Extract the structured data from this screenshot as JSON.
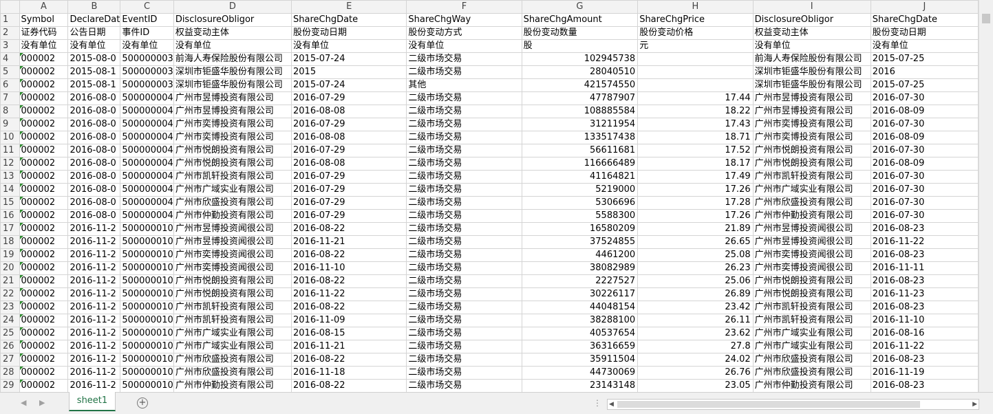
{
  "columns": [
    {
      "letter": "A",
      "w": 72
    },
    {
      "letter": "B",
      "w": 72
    },
    {
      "letter": "C",
      "w": 72
    },
    {
      "letter": "D",
      "w": 172
    },
    {
      "letter": "E",
      "w": 172
    },
    {
      "letter": "F",
      "w": 172
    },
    {
      "letter": "G",
      "w": 172
    },
    {
      "letter": "H",
      "w": 172
    },
    {
      "letter": "I",
      "w": 172
    },
    {
      "letter": "J",
      "w": 160
    }
  ],
  "rows": [
    [
      "Symbol",
      "DeclareDat",
      "EventID",
      "DisclosureObligor",
      "ShareChgDate",
      "ShareChgWay",
      "ShareChgAmount",
      "ShareChgPrice",
      "DisclosureObligor",
      "ShareChgDate"
    ],
    [
      "证券代码",
      "公告日期",
      "事件ID",
      "权益变动主体",
      "股份变动日期",
      "股份变动方式",
      "股份变动数量",
      "股份变动价格",
      "权益变动主体",
      "股份变动日期"
    ],
    [
      "没有单位",
      "没有单位",
      "没有单位",
      "没有单位",
      "没有单位",
      "没有单位",
      "股",
      "元",
      "没有单位",
      "没有单位"
    ],
    [
      "000002",
      "2015-08-0",
      "500000003",
      "前海人寿保险股份有限公司",
      "2015-07-24",
      "二级市场交易",
      "102945738",
      "",
      "前海人寿保险股份有限公司",
      "2015-07-25"
    ],
    [
      "000002",
      "2015-08-1",
      "500000003",
      "深圳市钜盛华股份有限公司",
      "2015",
      "二级市场交易",
      "28040510",
      "",
      "深圳市钜盛华股份有限公司",
      "2016"
    ],
    [
      "000002",
      "2015-08-1",
      "500000003",
      "深圳市钜盛华股份有限公司",
      "2015-07-24",
      "其他",
      "421574550",
      "",
      "深圳市钜盛华股份有限公司",
      "2015-07-25"
    ],
    [
      "000002",
      "2016-08-0",
      "500000004",
      "广州市昱博投资有限公司",
      "2016-07-29",
      "二级市场交易",
      "47787907",
      "17.44",
      "广州市昱博投资有限公司",
      "2016-07-30"
    ],
    [
      "000002",
      "2016-08-0",
      "500000004",
      "广州市昱博投资有限公司",
      "2016-08-08",
      "二级市场交易",
      "108885584",
      "18.22",
      "广州市昱博投资有限公司",
      "2016-08-09"
    ],
    [
      "000002",
      "2016-08-0",
      "500000004",
      "广州市奕博投资有限公司",
      "2016-07-29",
      "二级市场交易",
      "31211954",
      "17.43",
      "广州市奕博投资有限公司",
      "2016-07-30"
    ],
    [
      "000002",
      "2016-08-0",
      "500000004",
      "广州市奕博投资有限公司",
      "2016-08-08",
      "二级市场交易",
      "133517438",
      "18.71",
      "广州市奕博投资有限公司",
      "2016-08-09"
    ],
    [
      "000002",
      "2016-08-0",
      "500000004",
      "广州市悦朗投资有限公司",
      "2016-07-29",
      "二级市场交易",
      "56611681",
      "17.52",
      "广州市悦朗投资有限公司",
      "2016-07-30"
    ],
    [
      "000002",
      "2016-08-0",
      "500000004",
      "广州市悦朗投资有限公司",
      "2016-08-08",
      "二级市场交易",
      "116666489",
      "18.17",
      "广州市悦朗投资有限公司",
      "2016-08-09"
    ],
    [
      "000002",
      "2016-08-0",
      "500000004",
      "广州市凯轩投资有限公司",
      "2016-07-29",
      "二级市场交易",
      "41164821",
      "17.49",
      "广州市凯轩投资有限公司",
      "2016-07-30"
    ],
    [
      "000002",
      "2016-08-0",
      "500000004",
      "广州市广域实业有限公司",
      "2016-07-29",
      "二级市场交易",
      "5219000",
      "17.26",
      "广州市广域实业有限公司",
      "2016-07-30"
    ],
    [
      "000002",
      "2016-08-0",
      "500000004",
      "广州市欣盛投资有限公司",
      "2016-07-29",
      "二级市场交易",
      "5306696",
      "17.28",
      "广州市欣盛投资有限公司",
      "2016-07-30"
    ],
    [
      "000002",
      "2016-08-0",
      "500000004",
      "广州市仲勤投资有限公司",
      "2016-07-29",
      "二级市场交易",
      "5588300",
      "17.26",
      "广州市仲勤投资有限公司",
      "2016-07-30"
    ],
    [
      "000002",
      "2016-11-2",
      "500000010",
      "广州市昱博投资闻很公司",
      "2016-08-22",
      "二级市场交易",
      "16580209",
      "21.89",
      "广州市昱博投资闻很公司",
      "2016-08-23"
    ],
    [
      "000002",
      "2016-11-2",
      "500000010",
      "广州市昱博投资闻很公司",
      "2016-11-21",
      "二级市场交易",
      "37524855",
      "26.65",
      "广州市昱博投资闻很公司",
      "2016-11-22"
    ],
    [
      "000002",
      "2016-11-2",
      "500000010",
      "广州市奕博投资闻很公司",
      "2016-08-22",
      "二级市场交易",
      "4461200",
      "25.08",
      "广州市奕博投资闻很公司",
      "2016-08-23"
    ],
    [
      "000002",
      "2016-11-2",
      "500000010",
      "广州市奕博投资闻很公司",
      "2016-11-10",
      "二级市场交易",
      "38082989",
      "26.23",
      "广州市奕博投资闻很公司",
      "2016-11-11"
    ],
    [
      "000002",
      "2016-11-2",
      "500000010",
      "广州市悦朗投资有限公司",
      "2016-08-22",
      "二级市场交易",
      "2227527",
      "25.06",
      "广州市悦朗投资有限公司",
      "2016-08-23"
    ],
    [
      "000002",
      "2016-11-2",
      "500000010",
      "广州市悦朗投资有限公司",
      "2016-11-22",
      "二级市场交易",
      "30226117",
      "26.89",
      "广州市悦朗投资有限公司",
      "2016-11-23"
    ],
    [
      "000002",
      "2016-11-2",
      "500000010",
      "广州市凯轩投资有限公司",
      "2016-08-22",
      "二级市场交易",
      "44048154",
      "23.42",
      "广州市凯轩投资有限公司",
      "2016-08-23"
    ],
    [
      "000002",
      "2016-11-2",
      "500000010",
      "广州市凯轩投资有限公司",
      "2016-11-09",
      "二级市场交易",
      "38288100",
      "26.11",
      "广州市凯轩投资有限公司",
      "2016-11-10"
    ],
    [
      "000002",
      "2016-11-2",
      "500000010",
      "广州市广域实业有限公司",
      "2016-08-15",
      "二级市场交易",
      "40537654",
      "23.62",
      "广州市广域实业有限公司",
      "2016-08-16"
    ],
    [
      "000002",
      "2016-11-2",
      "500000010",
      "广州市广域实业有限公司",
      "2016-11-21",
      "二级市场交易",
      "36316659",
      "27.8",
      "广州市广域实业有限公司",
      "2016-11-22"
    ],
    [
      "000002",
      "2016-11-2",
      "500000010",
      "广州市欣盛投资有限公司",
      "2016-08-22",
      "二级市场交易",
      "35911504",
      "24.02",
      "广州市欣盛投资有限公司",
      "2016-08-23"
    ],
    [
      "000002",
      "2016-11-2",
      "500000010",
      "广州市欣盛投资有限公司",
      "2016-11-18",
      "二级市场交易",
      "44730069",
      "26.76",
      "广州市欣盛投资有限公司",
      "2016-11-19"
    ],
    [
      "000002",
      "2016-11-2",
      "500000010",
      "广州市仲勤投资有限公司",
      "2016-08-22",
      "二级市场交易",
      "23143148",
      "23.05",
      "广州市仲勤投资有限公司",
      "2016-08-23"
    ]
  ],
  "sheet_tab": "sheet1",
  "add_sheet_symbol": "+",
  "nav_prev": "◀",
  "nav_next": "▶"
}
